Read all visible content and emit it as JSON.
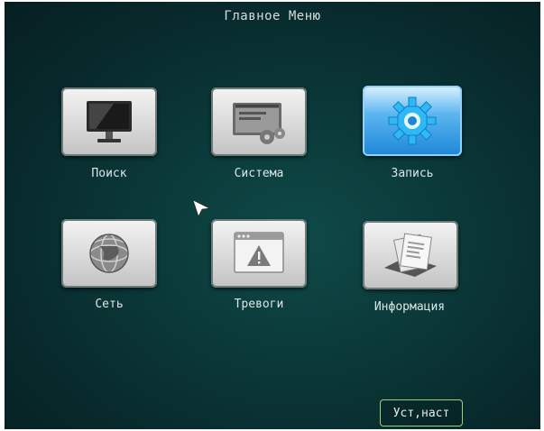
{
  "menu": {
    "title": "Главное Меню"
  },
  "items": [
    {
      "label": "Поиск",
      "icon": "monitor-icon"
    },
    {
      "label": "Система",
      "icon": "system-settings-icon"
    },
    {
      "label": "Запись",
      "icon": "gear-icon",
      "selected": true
    },
    {
      "label": "Сеть",
      "icon": "globe-network-icon"
    },
    {
      "label": "Тревоги",
      "icon": "warning-window-icon"
    },
    {
      "label": "Информация",
      "icon": "documents-icon"
    }
  ],
  "footer": {
    "default_button_label": "Уст,наст"
  },
  "colors": {
    "background": "#0b3a3a",
    "selected_accent": "#1d86d8",
    "button_border": "#9ecf7a"
  }
}
